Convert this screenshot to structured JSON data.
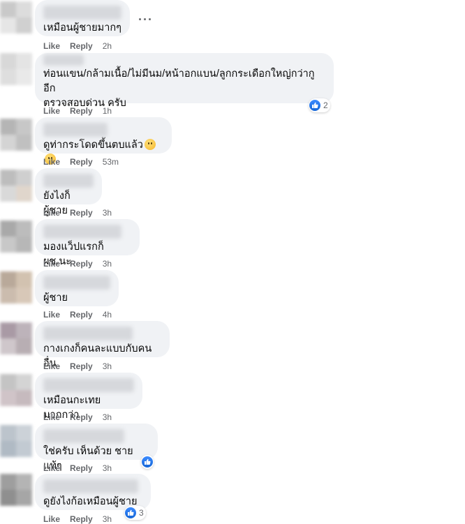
{
  "more_icon": "more-horizontal-icon",
  "like_label": "Like",
  "reply_label": "Reply",
  "comments": [
    {
      "text": "เหมือนผู้ชายมากๆ",
      "time": "2h"
    },
    {
      "text": "ท่อนแขน/กล้ามเนื้อ/ไม่มีนม/หน้าอกแบน/ลูกกระเดือกใหญ่กว่ากูอีก\nตรวจสอบด่วน ครับ",
      "time": "1h",
      "reactions": "2"
    },
    {
      "text": "ดูท่ากระโดดขึ้นตบแล้ว",
      "emojis": [
        "thinking-face-icon",
        "grimacing-face-icon"
      ],
      "time": "53m"
    },
    {
      "text": "ยังไงก็ผู้ชาย",
      "time": "3h"
    },
    {
      "text": "มองแว็ปแรกก็ ผช.นะ",
      "time": "3h"
    },
    {
      "text": "ผู้ชาย",
      "time": "4h"
    },
    {
      "text": "กางเกงก็คนละแบบกับคนอื่น",
      "time": "3h"
    },
    {
      "text": "เหมือนกะเทยมากกว่า",
      "time": "3h"
    },
    {
      "text": "ใช่ครับ เห็นด้วย ชายแท้ๆ",
      "time": "3h",
      "reactions": ""
    },
    {
      "text": "ดูยังไงก้อเหมือนผู้ชาย",
      "time": "3h",
      "reactions": "3"
    }
  ]
}
